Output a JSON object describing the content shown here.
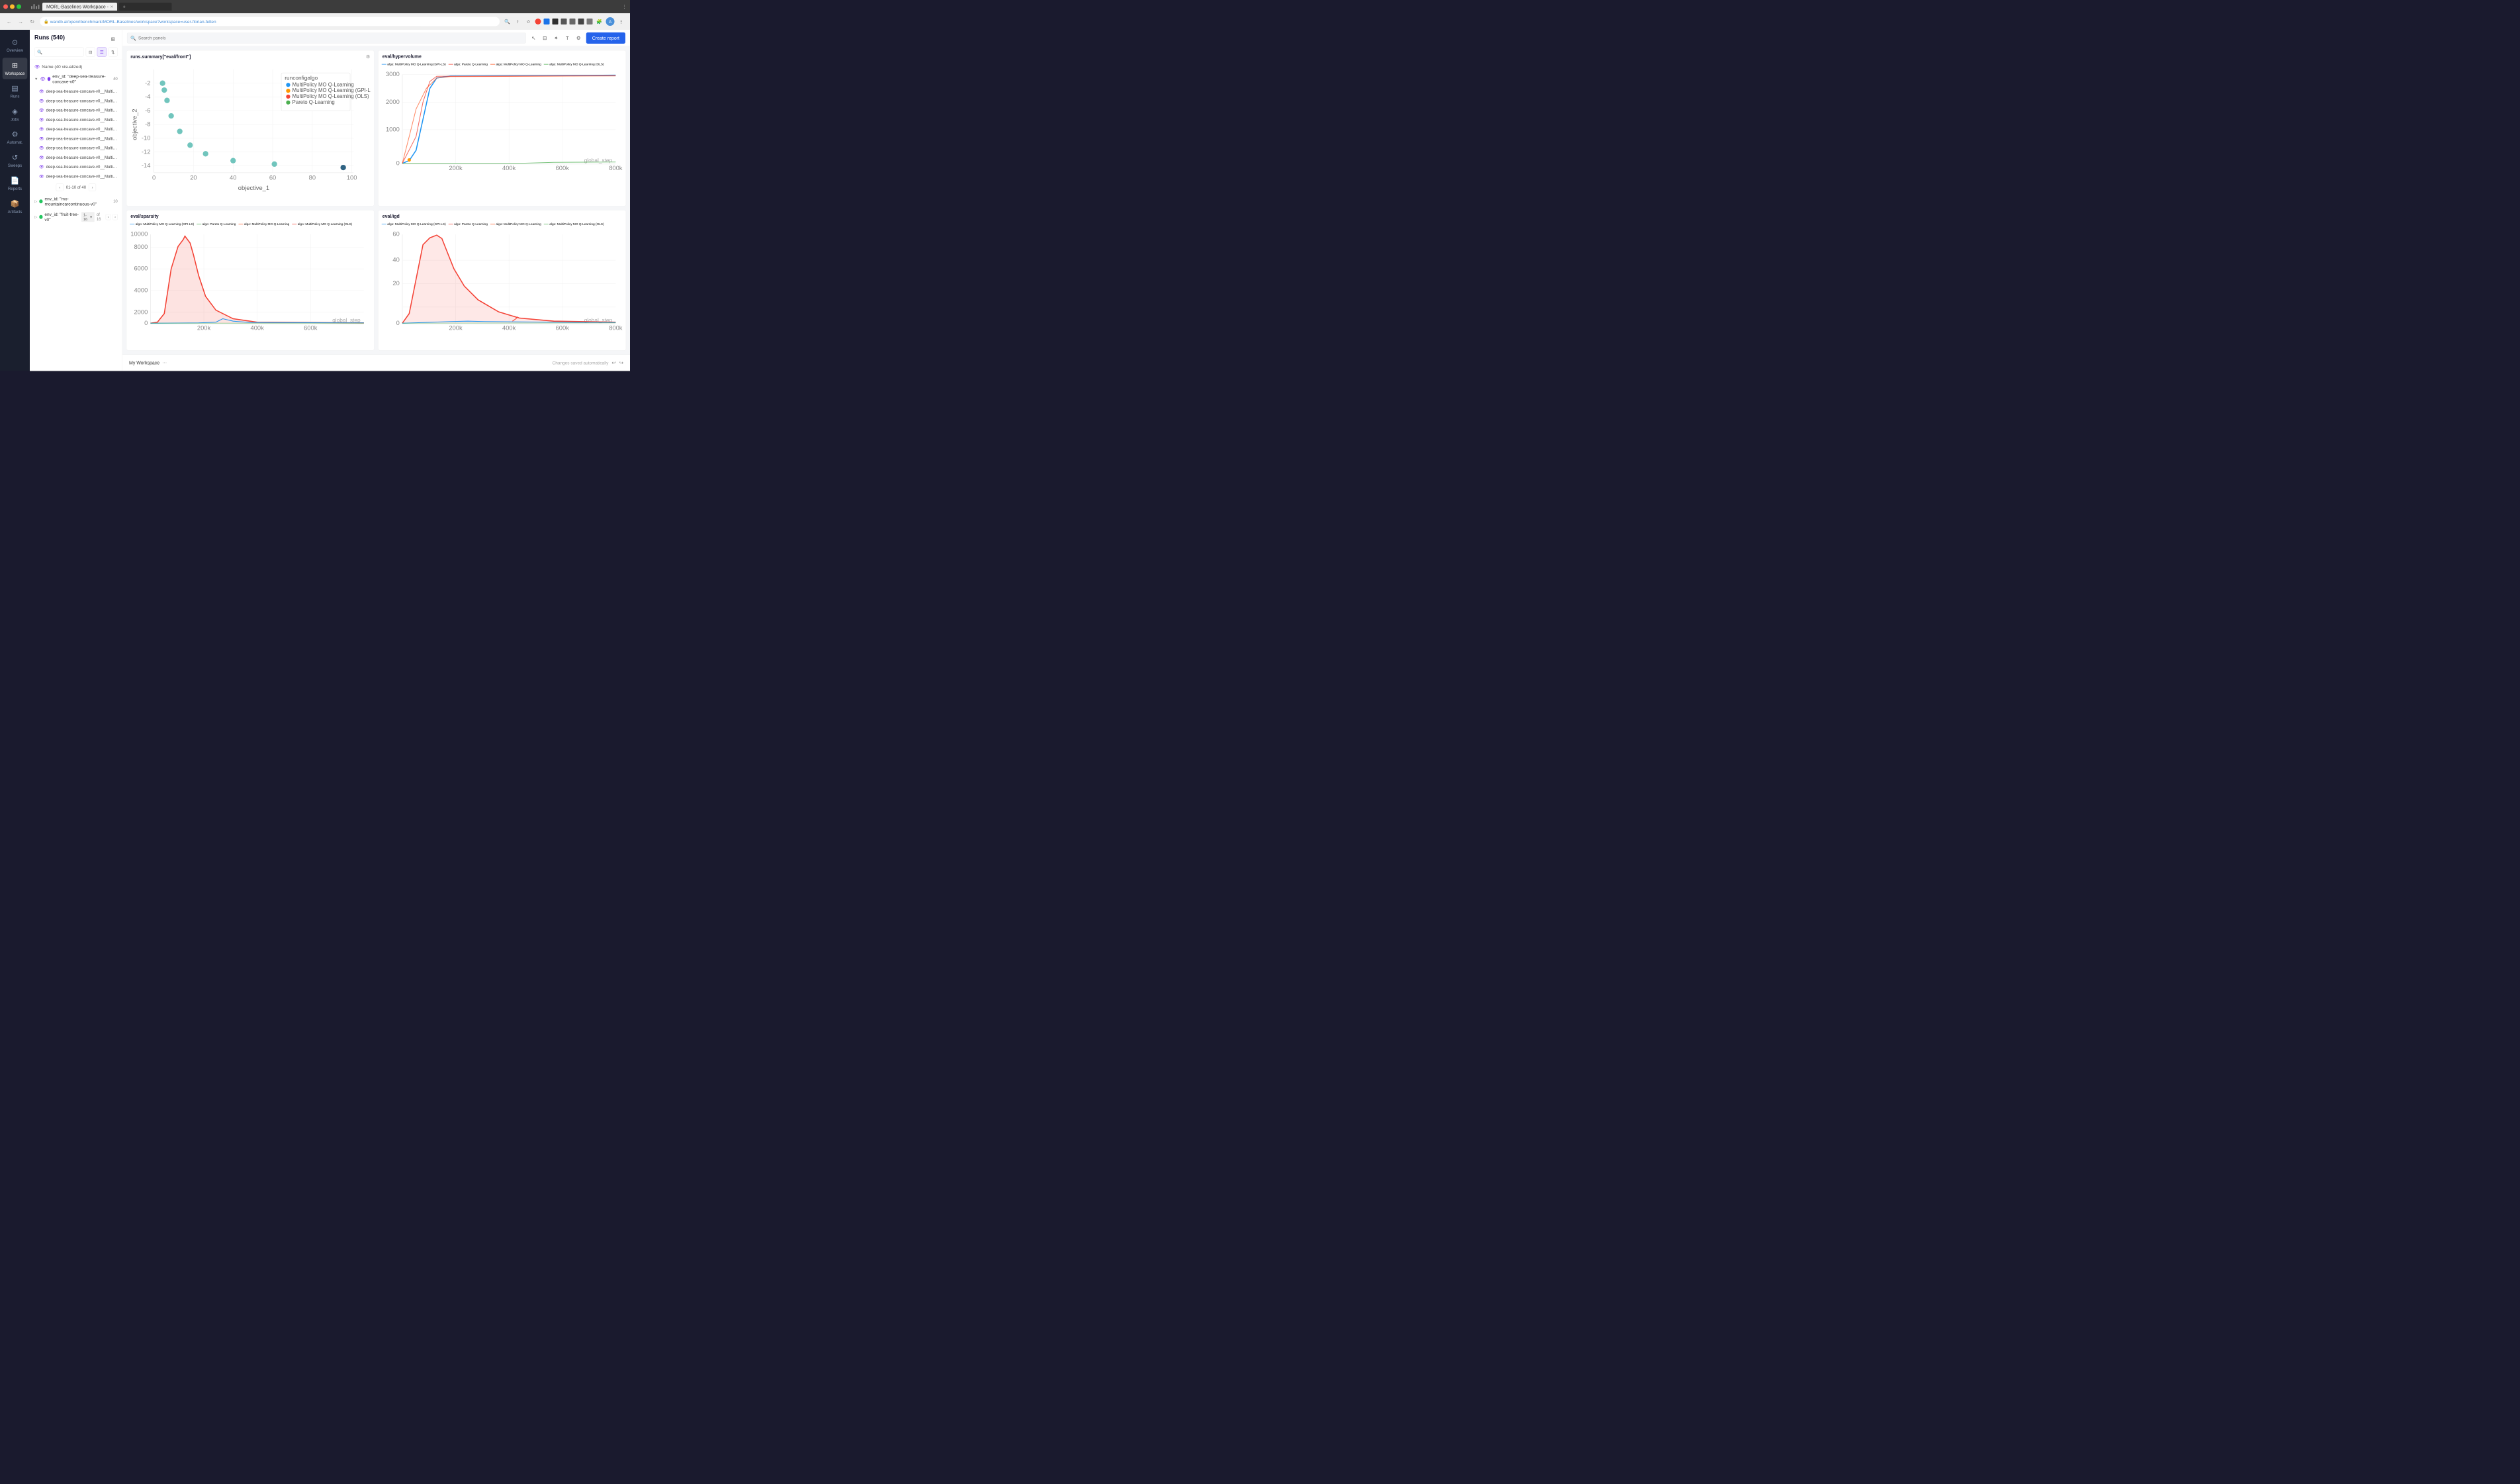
{
  "browser": {
    "tab_title": "MORL-Baselines Workspace -",
    "url": "wandb.ai/openrlbenchmark/MORL-Baselines/workspace?workspace=user-florian-felten",
    "new_tab_label": "+"
  },
  "sidebar": {
    "items": [
      {
        "id": "overview",
        "label": "Overview",
        "icon": "⊙"
      },
      {
        "id": "workspace",
        "label": "Workspace",
        "icon": "⊞",
        "active": true
      },
      {
        "id": "runs",
        "label": "Runs",
        "icon": "▤"
      },
      {
        "id": "jobs",
        "label": "Jobs",
        "icon": "◈"
      },
      {
        "id": "automations",
        "label": "Automat.",
        "icon": "⚙"
      },
      {
        "id": "sweeps",
        "label": "Sweeps",
        "icon": "↺"
      },
      {
        "id": "reports",
        "label": "Reports",
        "icon": "📄"
      },
      {
        "id": "artifacts",
        "label": "Artifacts",
        "icon": "📦"
      }
    ]
  },
  "runs_panel": {
    "title": "Runs (540)",
    "columns_icon": "⊞",
    "search_placeholder": "",
    "name_header": "Name (40 visualized)",
    "groups": [
      {
        "id": "deep-sea",
        "dot_color": "#7c3aed",
        "label": "env_id: \"deep-sea-treasure-concave-v0\"",
        "count": 40,
        "items": [
          "deep-sea-treasure-concave-v0__MultiPolicy MO Q-...",
          "deep-sea-treasure-concave-v0__MultiPolicy MO Q-...",
          "deep-sea-treasure-concave-v0__MultiPolicy MO Q-...",
          "deep-sea-treasure-concave-v0__MultiPolicy MO Q-...",
          "deep-sea-treasure-concave-v0__MultiPolicy MO Q-...",
          "deep-sea-treasure-concave-v0__MultiPolicy MO Q-...",
          "deep-sea-treasure-concave-v0__MultiPolicy MO Q-...",
          "deep-sea-treasure-concave-v0__MultiPolicy MO Q-...",
          "deep-sea-treasure-concave-v0__MultiPolicy MO Q-...",
          "deep-sea-treasure-concave-v0__MultiPolicy MO Q-..."
        ],
        "pagination": "01-10 of 40"
      },
      {
        "id": "mountaincar",
        "dot_color": "#22c55e",
        "label": "env_id: \"mo-mountaincarcontinuous-v0\"",
        "count": 10
      },
      {
        "id": "fruittree",
        "dot_color": "#22c55e",
        "label": "env_id: \"fruit-tree-v0\"",
        "pagination_range": "1-16",
        "pagination_of": "of 16"
      }
    ]
  },
  "workspace": {
    "search_placeholder": "Search panels",
    "create_report_label": "Create report",
    "bottom_label": "My Workspace",
    "saved_text": "Changes saved automatically"
  },
  "charts": [
    {
      "id": "eval-front",
      "title": "runs.summary[\"eval/front\"]",
      "type": "scatter",
      "legend": [
        {
          "label": "MultiPolicy MO Q-Learning",
          "color": "#2196f3",
          "shape": "dot"
        },
        {
          "label": "MultiPolicy MO Q-Learning (GPI-LS)",
          "color": "#ff9800",
          "shape": "dot"
        },
        {
          "label": "MultiPolicy MO Q-Learning (OLS)",
          "color": "#f44336",
          "shape": "dot"
        },
        {
          "label": "Pareto Q-Learning",
          "color": "#4caf50",
          "shape": "dot"
        }
      ],
      "x_axis": "objective_1",
      "y_axis": "objective_2",
      "has_settings": true
    },
    {
      "id": "eval-hypervolume",
      "title": "eval/hypervolume",
      "type": "line",
      "legend": [
        {
          "label": "algo: MultiPolicy MO Q-Learning (GPI-LS)",
          "color": "#2196f3"
        },
        {
          "label": "algo: Pareto Q-Learning",
          "color": "#f44336"
        },
        {
          "label": "algo: MultiPolicy MO Q-Learning",
          "color": "#ff5722"
        },
        {
          "label": "algo: MultiPolicy MO Q-Learning (OLS)",
          "color": "#4caf50"
        }
      ],
      "x_axis": "global_step",
      "y_max": 3000,
      "has_settings": false
    },
    {
      "id": "eval-sparsity",
      "title": "eval/sparsity",
      "type": "line",
      "legend": [
        {
          "label": "algo: MultiPolicy MO Q-Learning (GPI-LS)",
          "color": "#2196f3"
        },
        {
          "label": "algo: Pareto Q-Learning",
          "color": "#4caf50"
        },
        {
          "label": "algo: MultiPolicy MO Q-Learning",
          "color": "#ff5722"
        },
        {
          "label": "algo: MultiPolicy MO Q-Learning (OLS)",
          "color": "#f44336"
        }
      ],
      "x_axis": "global_step",
      "y_max": 10000,
      "has_settings": false
    },
    {
      "id": "eval-igd",
      "title": "eval/igd",
      "type": "line",
      "legend": [
        {
          "label": "algo: MultiPolicy MO Q-Learning (GPI-LS)",
          "color": "#2196f3"
        },
        {
          "label": "algo: Pareto Q-Learning",
          "color": "#f44336"
        },
        {
          "label": "algo: MultiPolicy MO Q-Learning",
          "color": "#ff5722"
        },
        {
          "label": "algo: MultiPolicy MO Q-Learning (OLS)",
          "color": "#4caf50"
        }
      ],
      "x_axis": "global_step",
      "y_max": 60,
      "has_settings": false
    }
  ]
}
